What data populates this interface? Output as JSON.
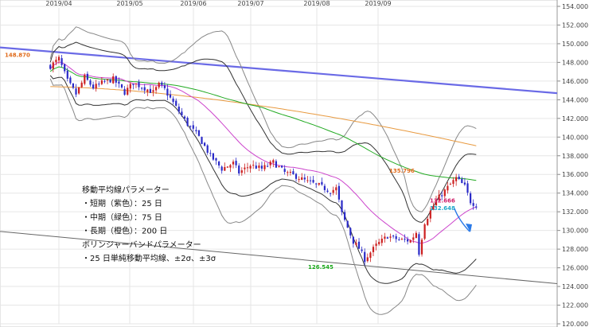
{
  "chart_data": {
    "type": "candlestick",
    "x_axis": {
      "ticks": [
        "2019/04",
        "2019/05",
        "2019/06",
        "2019/07",
        "2019/08",
        "2019/09"
      ]
    },
    "y_axis": {
      "range": [
        120,
        154
      ],
      "ticks": [
        "120.000",
        "122.000",
        "124.000",
        "126.000",
        "128.000",
        "130.000",
        "132.000",
        "134.000",
        "136.000",
        "138.000",
        "140.000",
        "142.000",
        "144.000",
        "146.000",
        "148.000",
        "150.000",
        "152.000",
        "154.000"
      ]
    },
    "grid": true,
    "point_labels": [
      {
        "label": "148.870",
        "color": "#e06a1a"
      },
      {
        "label": "135.796",
        "color": "#e06a1a"
      },
      {
        "label": "126.545",
        "color": "#1aa81a"
      }
    ],
    "last_value_labels": [
      {
        "label": "132.666",
        "color": "#d0206a"
      },
      {
        "label": "132.648",
        "color": "#20a8c8"
      }
    ],
    "annotation_lines": [
      "移動平均線パラメーター",
      "・短期（紫色）：25 日",
      "・中期（緑色）：75 日",
      "・長期（橙色）：200 日",
      "ボリンジャーバンドパラメーター",
      "・25 日単純移動平均線、±2σ、±3σ"
    ],
    "series_colors": {
      "up": "#cc1f1f",
      "down": "#2a2ac8",
      "ma_short": "#cc44cc",
      "ma_mid": "#22aa22",
      "ma_long": "#e89a40",
      "bollinger_2": "#333333",
      "bollinger_3": "#888888",
      "trend_upper": "#6a6ae6",
      "trend_lower": "#666666",
      "forecast_arrow": "#2a7ae8"
    }
  }
}
